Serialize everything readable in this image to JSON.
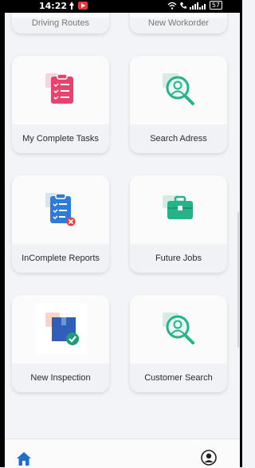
{
  "status_bar": {
    "time": "14:22",
    "battery": "57",
    "icons": [
      "notification-icon",
      "youtube-icon",
      "wifi-icon",
      "call-icon",
      "signal-icon"
    ]
  },
  "tiles": {
    "driving_routes": "Driving Routes",
    "new_workorder": "New Workorder",
    "my_complete_tasks": "My Complete Tasks",
    "search_adress": "Search Adress",
    "incomplete_reports": "InComplete Reports",
    "future_jobs": "Future Jobs",
    "new_inspection": "New Inspection",
    "customer_search": "Customer Search"
  },
  "bottom_nav": {
    "items": [
      "home-icon",
      "profile-icon"
    ]
  },
  "colors": {
    "pink_accent": "#e8436d",
    "green_accent": "#25b38a",
    "blue_accent": "#2f7bd8",
    "background": "#f3f4f7"
  }
}
